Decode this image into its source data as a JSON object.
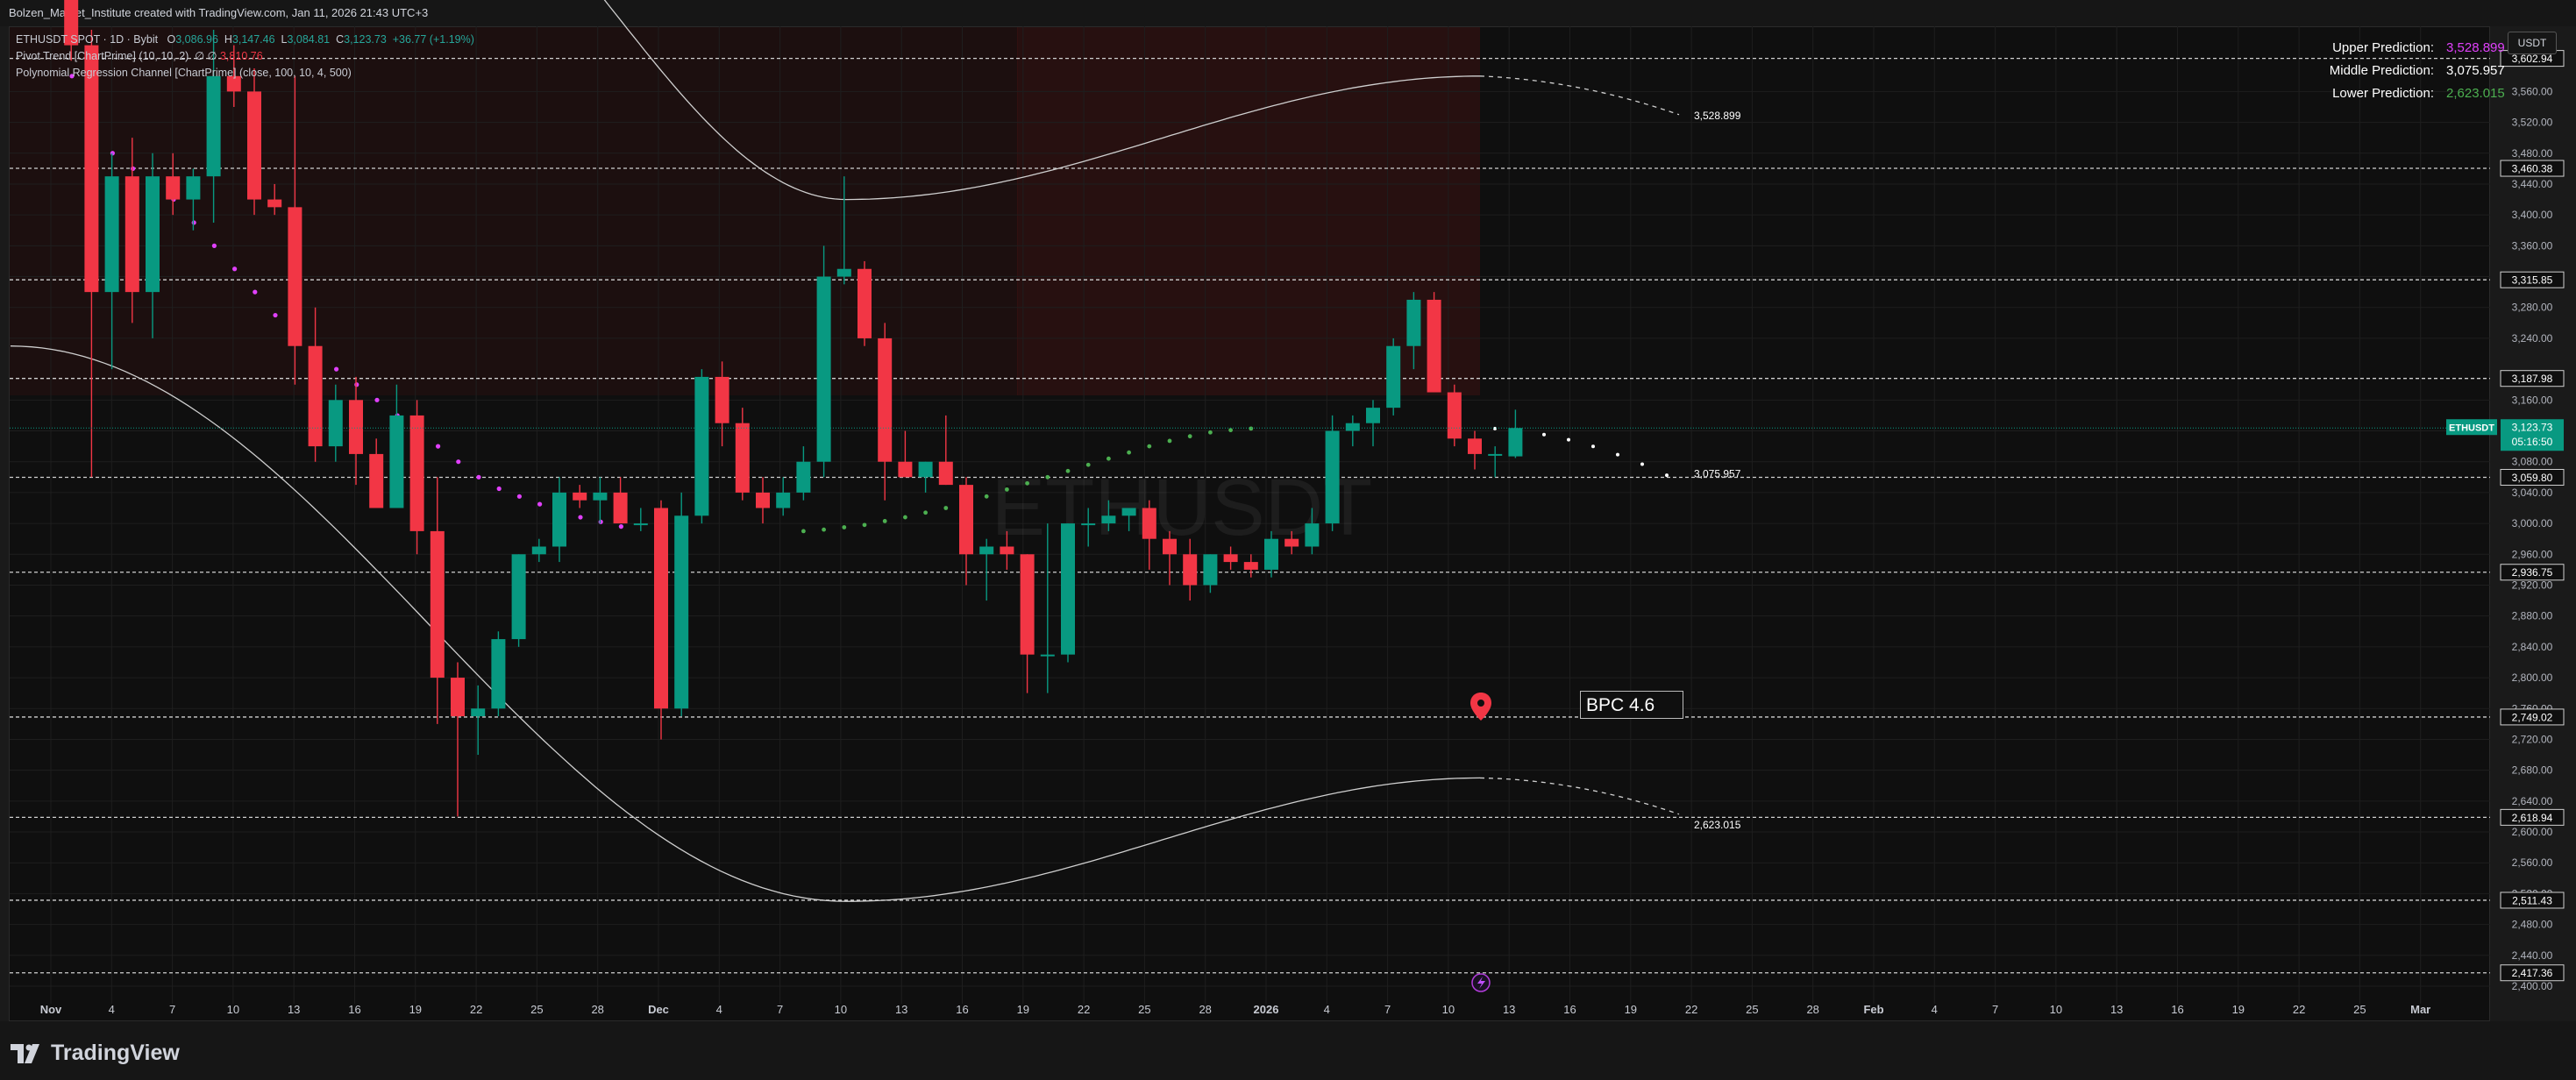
{
  "header": {
    "attribution": "Bolzen_Market_Institute created with TradingView.com, Jan 11, 2026 21:43 UTC+3"
  },
  "legend": {
    "symbol": "ETHUSDT SPOT · 1D · Bybit",
    "o_label": "O",
    "o_value": "3,086.96",
    "h_label": "H",
    "h_value": "3,147.46",
    "l_label": "L",
    "l_value": "3,084.81",
    "c_label": "C",
    "c_value": "3,123.73",
    "change": "+36.77 (+1.19%)",
    "pivot_trend": "Pivot Trend [ChartPrime] (10, 10, 2)",
    "pivot_value": "3,810.76",
    "poly_channel": "Polynomial Regression Channel [ChartPrime] (close, 100, 10, 4, 500)"
  },
  "predictions": {
    "upper_label": "Upper Prediction:",
    "upper_value": "3,528.899",
    "middle_label": "Middle Prediction:",
    "middle_value": "3,075.957",
    "lower_label": "Lower Prediction:",
    "lower_value": "2,623.015"
  },
  "currency_button": "USDT",
  "watermark": "ETHUSDT",
  "annotation": "BPC 4.6",
  "logo_text": "TradingView",
  "colors": {
    "bull": "#089981",
    "bear": "#f23645",
    "grid": "#1e1e1e",
    "pivot_bear": "#e040fb",
    "pivot_bull": "#4caf50",
    "channel": "#cfcfcf"
  },
  "chart_data": {
    "type": "candlestick",
    "symbol": "ETHUSDT",
    "timeframe": "1D",
    "x_axis_ticks": [
      "Nov",
      "4",
      "7",
      "10",
      "13",
      "16",
      "19",
      "22",
      "25",
      "28",
      "Dec",
      "4",
      "7",
      "10",
      "13",
      "16",
      "19",
      "22",
      "25",
      "28",
      "2026",
      "4",
      "7",
      "10",
      "13",
      "16",
      "19",
      "22",
      "25",
      "28",
      "Feb",
      "4",
      "7",
      "10",
      "13",
      "16",
      "19",
      "22",
      "25",
      "Mar"
    ],
    "y_axis_ticks": [
      "3,560.00",
      "3,520.00",
      "3,480.00",
      "3,440.00",
      "3,400.00",
      "3,360.00",
      "3,320.00",
      "3,280.00",
      "3,240.00",
      "3,160.00",
      "3,120.00",
      "3,080.00",
      "3,040.00",
      "3,000.00",
      "2,960.00",
      "2,920.00",
      "2,880.00",
      "2,840.00",
      "2,800.00",
      "2,760.00",
      "2,720.00",
      "2,680.00",
      "2,640.00",
      "2,600.00",
      "2,560.00",
      "2,520.00",
      "2,480.00",
      "2,440.00",
      "2,400.00"
    ],
    "ylim": [
      2400,
      3640
    ],
    "dates": [
      "Nov 1",
      "Nov 2",
      "Nov 3",
      "Nov 4",
      "Nov 5",
      "Nov 6",
      "Nov 7",
      "Nov 8",
      "Nov 9",
      "Nov 10",
      "Nov 11",
      "Nov 12",
      "Nov 13",
      "Nov 14",
      "Nov 15",
      "Nov 16",
      "Nov 17",
      "Nov 18",
      "Nov 19",
      "Nov 20",
      "Nov 21",
      "Nov 22",
      "Nov 23",
      "Nov 24",
      "Nov 25",
      "Nov 26",
      "Nov 27",
      "Nov 28",
      "Nov 29",
      "Nov 30",
      "Dec 1",
      "Dec 2",
      "Dec 3",
      "Dec 4",
      "Dec 5",
      "Dec 6",
      "Dec 7",
      "Dec 8",
      "Dec 9",
      "Dec 10",
      "Dec 11",
      "Dec 12",
      "Dec 13",
      "Dec 14",
      "Dec 15",
      "Dec 16",
      "Dec 17",
      "Dec 18",
      "Dec 19",
      "Dec 20",
      "Dec 21",
      "Dec 22",
      "Dec 23",
      "Dec 24",
      "Dec 25",
      "Dec 26",
      "Dec 27",
      "Dec 28",
      "Dec 29",
      "Dec 30",
      "Dec 31",
      "Jan 1",
      "Jan 2",
      "Jan 3",
      "Jan 4",
      "Jan 5",
      "Jan 6",
      "Jan 7",
      "Jan 8",
      "Jan 9",
      "Jan 10",
      "Jan 11"
    ],
    "ohlc": [
      [
        3860,
        3880,
        3810,
        3840
      ],
      [
        3840,
        3850,
        3600,
        3620
      ],
      [
        3620,
        3640,
        3060,
        3300
      ],
      [
        3300,
        3480,
        3200,
        3450
      ],
      [
        3450,
        3500,
        3260,
        3300
      ],
      [
        3300,
        3480,
        3240,
        3450
      ],
      [
        3450,
        3480,
        3400,
        3420
      ],
      [
        3420,
        3460,
        3380,
        3450
      ],
      [
        3450,
        3640,
        3390,
        3580
      ],
      [
        3580,
        3620,
        3540,
        3560
      ],
      [
        3560,
        3590,
        3400,
        3420
      ],
      [
        3420,
        3440,
        3400,
        3410
      ],
      [
        3410,
        3580,
        3180,
        3230
      ],
      [
        3230,
        3280,
        3080,
        3100
      ],
      [
        3100,
        3180,
        3080,
        3160
      ],
      [
        3160,
        3190,
        3050,
        3090
      ],
      [
        3090,
        3110,
        3030,
        3020
      ],
      [
        3020,
        3180,
        3030,
        3140
      ],
      [
        3140,
        3160,
        2960,
        2990
      ],
      [
        2990,
        3060,
        2740,
        2800
      ],
      [
        2800,
        2820,
        2620,
        2750
      ],
      [
        2750,
        2790,
        2700,
        2760
      ],
      [
        2760,
        2860,
        2750,
        2850
      ],
      [
        2850,
        2960,
        2840,
        2960
      ],
      [
        2960,
        2980,
        2950,
        2970
      ],
      [
        2970,
        3060,
        2950,
        3040
      ],
      [
        3040,
        3050,
        3020,
        3030
      ],
      [
        3030,
        3060,
        3000,
        3040
      ],
      [
        3040,
        3060,
        3000,
        3000
      ],
      [
        3000,
        3020,
        2990,
        3000
      ],
      [
        3020,
        3030,
        2720,
        2760
      ],
      [
        2760,
        3040,
        2750,
        3010
      ],
      [
        3010,
        3200,
        3000,
        3190
      ],
      [
        3190,
        3210,
        3100,
        3130
      ],
      [
        3130,
        3150,
        3030,
        3040
      ],
      [
        3040,
        3060,
        3000,
        3020
      ],
      [
        3020,
        3060,
        3010,
        3040
      ],
      [
        3040,
        3100,
        3030,
        3080
      ],
      [
        3080,
        3360,
        3060,
        3320
      ],
      [
        3320,
        3450,
        3310,
        3330
      ],
      [
        3330,
        3340,
        3230,
        3240
      ],
      [
        3240,
        3260,
        3030,
        3080
      ],
      [
        3080,
        3120,
        3060,
        3060
      ],
      [
        3060,
        3080,
        3040,
        3080
      ],
      [
        3080,
        3140,
        3050,
        3050
      ],
      [
        3050,
        3060,
        2920,
        2960
      ],
      [
        2960,
        2980,
        2900,
        2970
      ],
      [
        2970,
        2990,
        2940,
        2960
      ],
      [
        2960,
        2960,
        2780,
        2830
      ],
      [
        2830,
        3000,
        2780,
        2830
      ],
      [
        2830,
        3000,
        2820,
        3000
      ],
      [
        3000,
        3020,
        2970,
        3000
      ],
      [
        3000,
        3030,
        2990,
        3010
      ],
      [
        3010,
        3020,
        2990,
        3020
      ],
      [
        3020,
        3030,
        2940,
        2980
      ],
      [
        2980,
        2990,
        2920,
        2960
      ],
      [
        2960,
        2980,
        2900,
        2920
      ],
      [
        2920,
        2960,
        2910,
        2960
      ],
      [
        2960,
        2970,
        2940,
        2950
      ],
      [
        2950,
        2960,
        2930,
        2940
      ],
      [
        2940,
        2990,
        2930,
        2980
      ],
      [
        2980,
        2990,
        2960,
        2970
      ],
      [
        2970,
        3020,
        2960,
        3000
      ],
      [
        3000,
        3140,
        2990,
        3120
      ],
      [
        3120,
        3140,
        3100,
        3130
      ],
      [
        3130,
        3160,
        3100,
        3150
      ],
      [
        3150,
        3240,
        3140,
        3230
      ],
      [
        3230,
        3300,
        3200,
        3290
      ],
      [
        3290,
        3300,
        3170,
        3170
      ],
      [
        3170,
        3180,
        3100,
        3110
      ],
      [
        3110,
        3120,
        3070,
        3090
      ],
      [
        3090,
        3100,
        3060,
        3090
      ],
      [
        3086.96,
        3147.46,
        3084.81,
        3123.73
      ]
    ],
    "pivot_trend": {
      "name": "Pivot Trend",
      "bear_values": [
        3580,
        3520,
        3480,
        3460,
        3440,
        3420,
        3390,
        3360,
        3330,
        3300,
        3270,
        3240,
        3220,
        3200,
        3180,
        3160,
        3140,
        3120,
        3100,
        3080,
        3060,
        3045,
        3035,
        3025,
        3015,
        3008,
        3002,
        2996
      ],
      "bull_values": [
        2990,
        2992,
        2995,
        2998,
        3003,
        3008,
        3014,
        3020,
        3027,
        3035,
        3044,
        3052,
        3060,
        3068,
        3076,
        3084,
        3092,
        3100,
        3107,
        3113,
        3118,
        3121,
        3123
      ]
    },
    "regression_channel": {
      "name": "Polynomial Regression Channel",
      "upper_prediction": 3528.899,
      "middle_prediction": 3075.957,
      "lower_prediction": 2623.015
    },
    "price_levels": [
      {
        "value": "3,602.94"
      },
      {
        "value": "3,460.38"
      },
      {
        "value": "3,315.85"
      },
      {
        "value": "3,187.98"
      },
      {
        "value": "3,059.80"
      },
      {
        "value": "2,936.75"
      },
      {
        "value": "2,749.02"
      },
      {
        "value": "2,618.94"
      },
      {
        "value": "2,511.43"
      },
      {
        "value": "2,417.36"
      }
    ],
    "last_price": {
      "label": "ETHUSDT",
      "value": "3,123.73",
      "countdown": "05:16:50"
    },
    "prediction_labels": {
      "upper": "3,528.899",
      "middle": "3,075.957",
      "lower": "2,623.015"
    }
  }
}
